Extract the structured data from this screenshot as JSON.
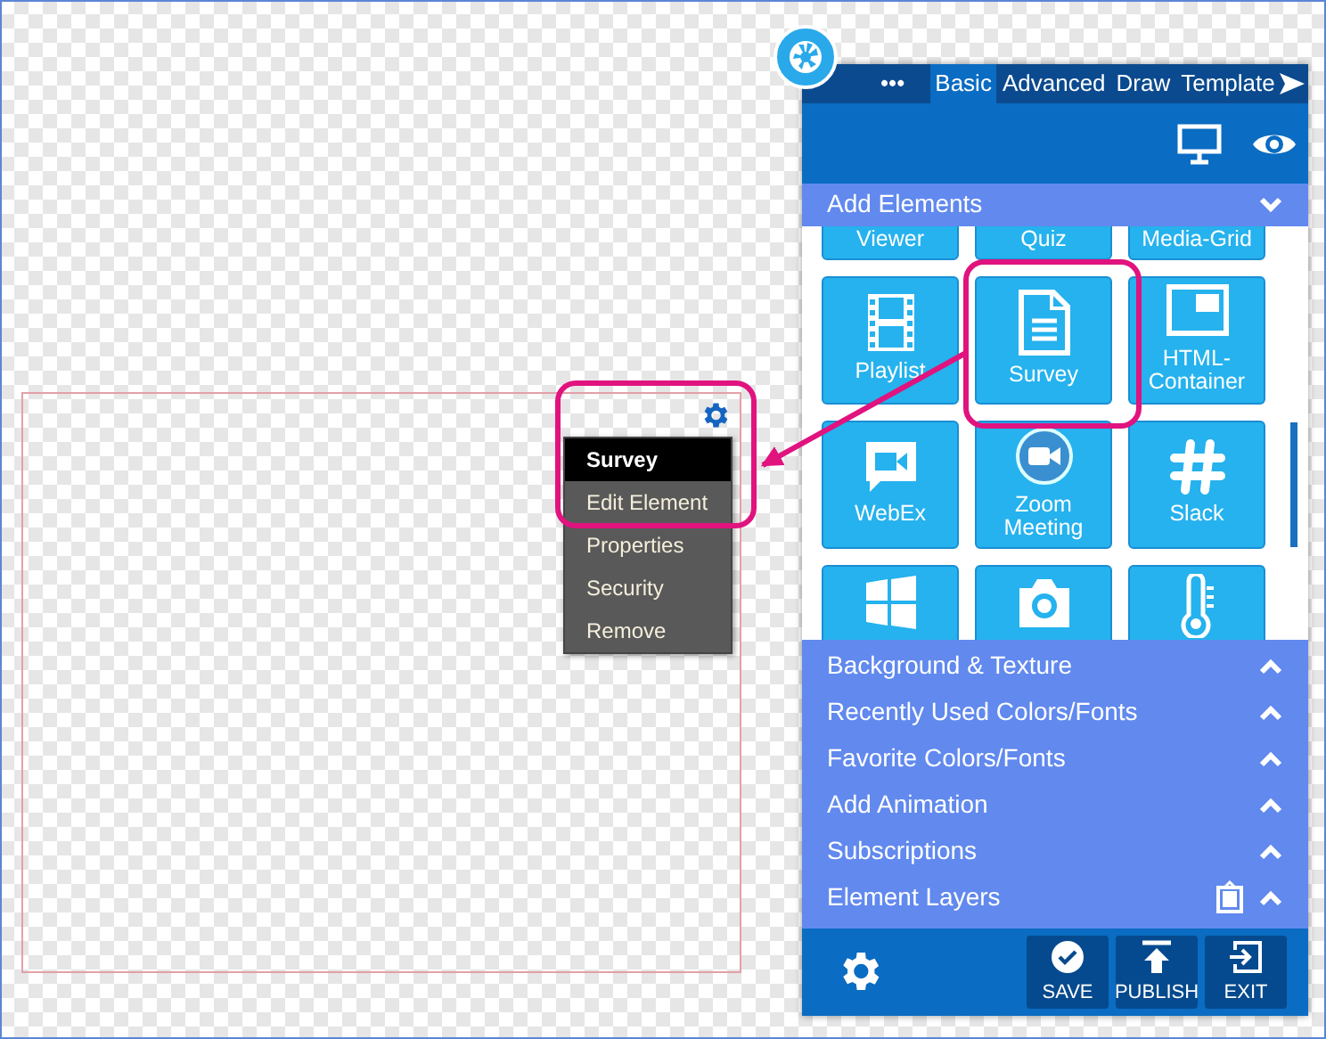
{
  "context_menu": {
    "items": [
      {
        "label": "Survey",
        "kind": "title"
      },
      {
        "label": "Edit Element",
        "kind": "item"
      },
      {
        "label": "Properties",
        "kind": "item"
      },
      {
        "label": "Security",
        "kind": "item"
      },
      {
        "label": "Remove",
        "kind": "item"
      }
    ]
  },
  "panel": {
    "tabs": [
      {
        "label": "•••",
        "selected": false
      },
      {
        "label": "Basic",
        "selected": true
      },
      {
        "label": "Advanced",
        "selected": false
      },
      {
        "label": "Draw",
        "selected": false
      },
      {
        "label": "Template",
        "selected": false
      }
    ],
    "elements_section": {
      "label": "Add Elements",
      "expanded": true
    },
    "tiles": [
      {
        "label": "Viewer",
        "kind": "none"
      },
      {
        "label": "Quiz",
        "kind": "none"
      },
      {
        "label": "Media-Grid",
        "kind": "none"
      },
      {
        "label": "Playlist",
        "kind": "film"
      },
      {
        "label": "Survey",
        "kind": "document"
      },
      {
        "label": "HTML-Container",
        "kind": "window"
      },
      {
        "label": "WebEx",
        "kind": "videochat"
      },
      {
        "label": "Zoom Meeting",
        "kind": "videocam"
      },
      {
        "label": "Slack",
        "kind": "hash"
      },
      {
        "kind": "windows"
      },
      {
        "kind": "camera"
      },
      {
        "kind": "thermometer"
      }
    ],
    "sections": [
      {
        "label": "Background & Texture",
        "expanded": false,
        "kind": "plain"
      },
      {
        "label": "Recently Used Colors/Fonts",
        "expanded": false,
        "kind": "plain"
      },
      {
        "label": "Favorite Colors/Fonts",
        "expanded": false,
        "kind": "plain"
      },
      {
        "label": "Add Animation",
        "expanded": false,
        "kind": "plain"
      },
      {
        "label": "Subscriptions",
        "expanded": false,
        "kind": "plain"
      },
      {
        "label": "Element Layers",
        "expanded": false,
        "kind": "clipboard"
      }
    ],
    "footer_buttons": [
      {
        "label": "SAVE",
        "kind": "save"
      },
      {
        "label": "PUBLISH",
        "kind": "publish"
      },
      {
        "label": "EXIT",
        "kind": "exit"
      }
    ]
  }
}
